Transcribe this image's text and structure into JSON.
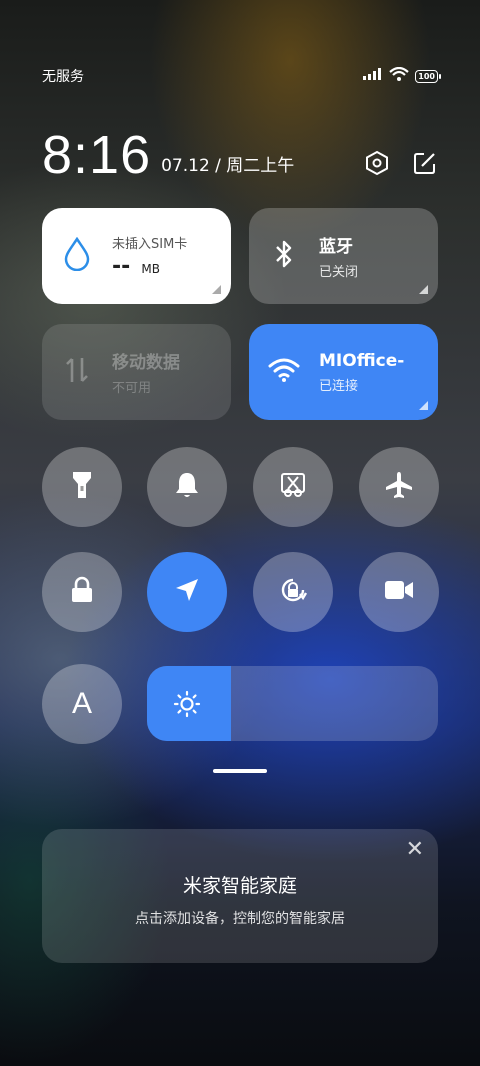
{
  "status_bar": {
    "carrier": "无服务",
    "battery_level": "100",
    "icons": [
      "signal-icon",
      "wifi-icon",
      "battery-icon"
    ]
  },
  "header": {
    "time": "8:16",
    "date": "07.12 / 周二上午",
    "icons": [
      "settings-icon",
      "edit-icon"
    ]
  },
  "tiles": {
    "sim": {
      "title": "未插入SIM卡",
      "value": "--",
      "unit": "MB"
    },
    "bluetooth": {
      "title": "蓝牙",
      "status": "已关闭"
    },
    "mobile_data": {
      "title": "移动数据",
      "status": "不可用"
    },
    "wifi": {
      "title": "MIOffice-",
      "status": "已连接"
    }
  },
  "toggles_row1": [
    "flashlight",
    "mute",
    "screenshot",
    "airplane-mode"
  ],
  "toggles_row2": [
    "rotation-lock",
    "location",
    "auto-rotate",
    "screen-record"
  ],
  "brightness": {
    "level": 0.29,
    "auto_label": "A"
  },
  "smart_home": {
    "title": "米家智能家庭",
    "subtitle": "点击添加设备，控制您的智能家居",
    "close": "✕"
  },
  "colors": {
    "accent": "#3f86f5",
    "tile_active": "#ffffff"
  }
}
